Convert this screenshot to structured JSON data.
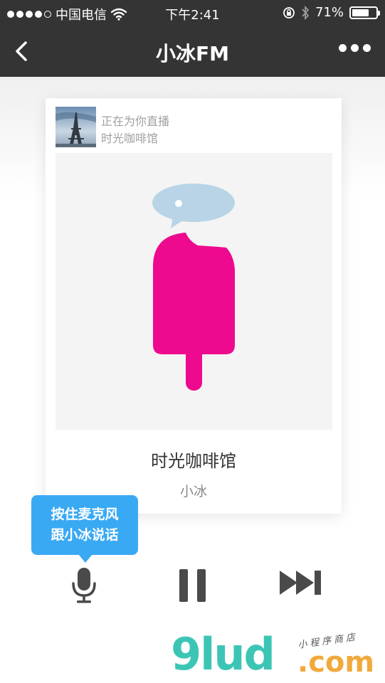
{
  "status_bar": {
    "carrier": "中国电信",
    "time": "下午2:41",
    "battery": "71%",
    "battery_level": 0.71
  },
  "nav": {
    "title": "小冰FM"
  },
  "card": {
    "live_label": "正在为你直播",
    "station": "时光咖啡馆",
    "song_title": "时光咖啡馆",
    "artist": "小冰"
  },
  "tooltip": {
    "line1": "按住麦克风",
    "line2": "跟小冰说话"
  },
  "controls": {
    "mic": "microphone-icon",
    "pause": "pause-icon",
    "next": "next-track-icon"
  },
  "watermark": {
    "logo": "9lud",
    "domain": ".com",
    "tagline": "小程序商店"
  },
  "colors": {
    "bar": "#343434",
    "accent": "#3aa9f4",
    "popsicle": "#ee0a8e",
    "bubble": "#b8d4e6"
  }
}
